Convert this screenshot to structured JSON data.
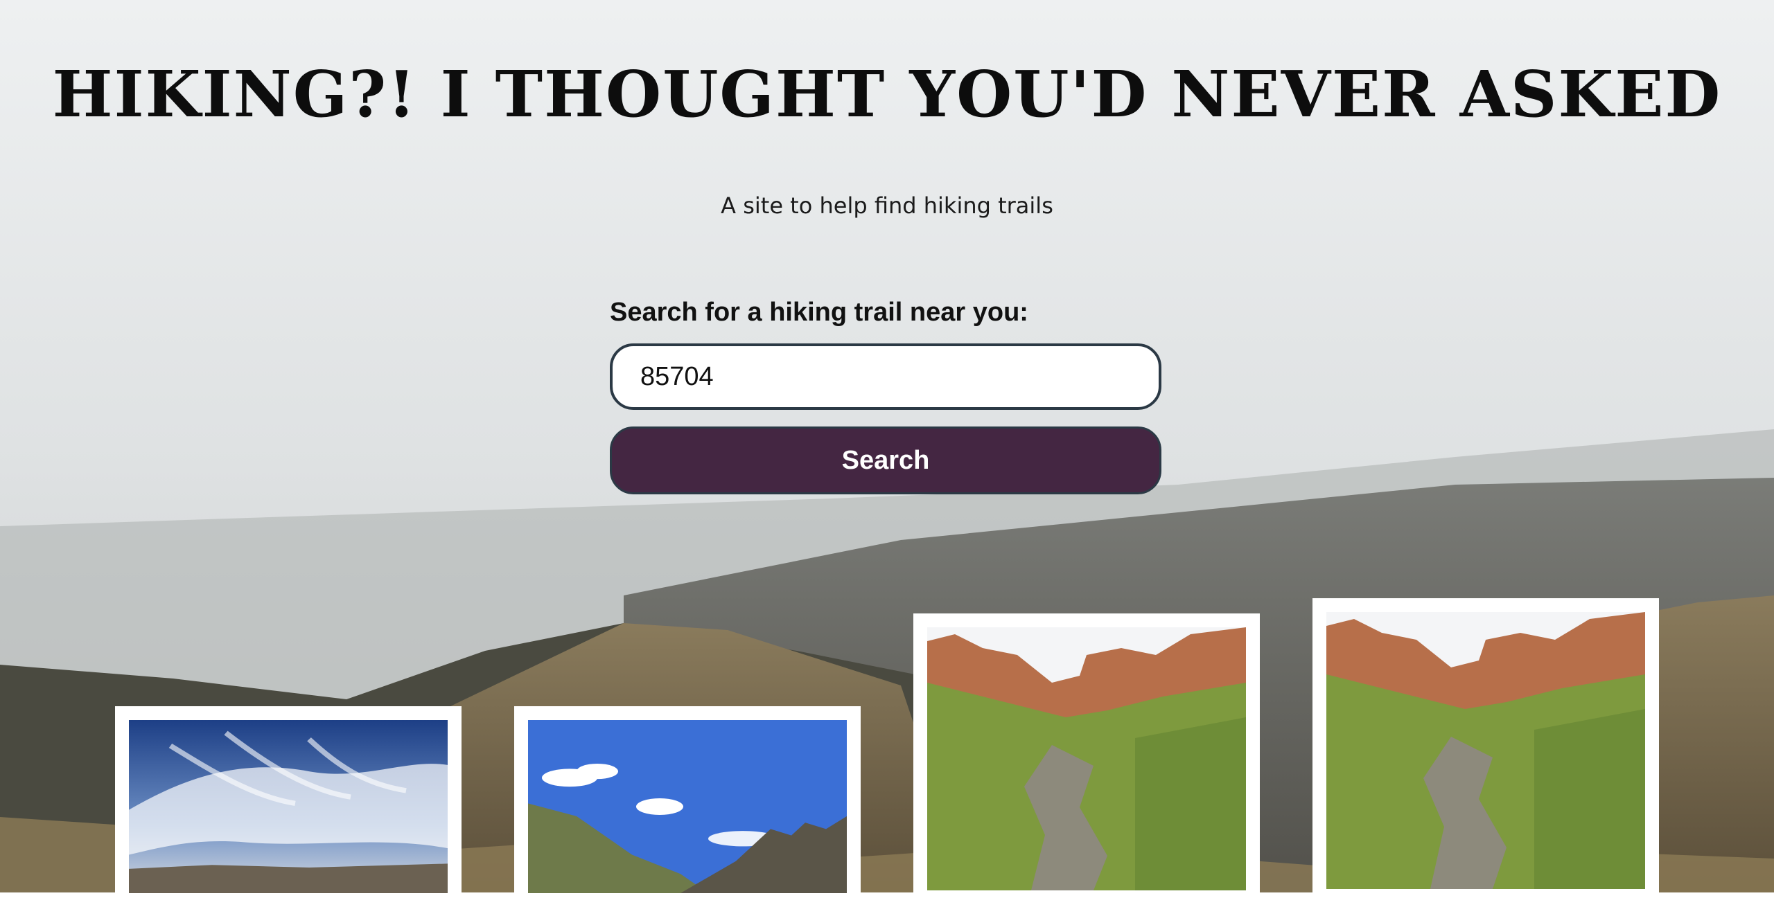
{
  "header": {
    "title": "HIKING?! I THOUGHT YOU'D NEVER ASKED",
    "subtitle": "A site to help find hiking trails"
  },
  "search": {
    "label": "Search for a hiking trail near you:",
    "value": "85704",
    "button_label": "Search"
  },
  "colors": {
    "button_bg": "#442642",
    "input_border": "#2b3945",
    "title_text": "#0d0d0d"
  }
}
